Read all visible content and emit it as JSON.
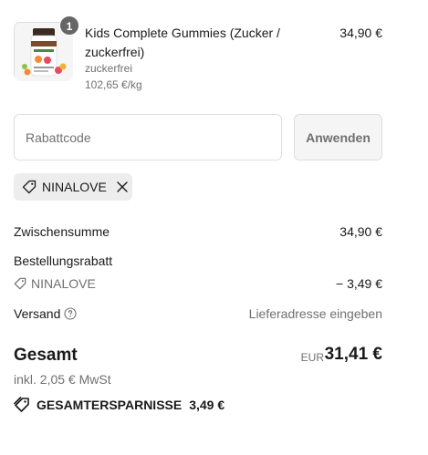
{
  "product": {
    "quantity": "1",
    "title": "Kids Complete Gummies (Zucker / zuckerfrei)",
    "variant": "zuckerfrei",
    "unit_price": "102,65 €/kg",
    "price": "34,90 €",
    "image_icon": "product-jar-image"
  },
  "discount": {
    "placeholder": "Rabattcode",
    "value": "",
    "apply_label": "Anwenden"
  },
  "applied_code": {
    "code": "NINALOVE",
    "icon": "tag-icon",
    "remove_icon": "close-icon"
  },
  "summary": {
    "subtotal_label": "Zwischensumme",
    "subtotal_value": "34,90 €",
    "order_discount_label": "Bestellungsrabatt",
    "order_discount_code": "NINALOVE",
    "order_discount_value": "− 3,49 €",
    "shipping_label": "Versand",
    "shipping_value": "Lieferadresse eingeben"
  },
  "total": {
    "label": "Gesamt",
    "currency": "EUR",
    "amount": "31,41 €",
    "tax_note": "inkl. 2,05 € MwSt"
  },
  "savings": {
    "label": "GESAMTERSPARNISSE",
    "value": "3,49 €"
  },
  "colors": {
    "text": "#1a1a1a",
    "muted": "#707070",
    "border": "#dedede",
    "tag_bg": "#ededed",
    "badge": "#666666"
  }
}
